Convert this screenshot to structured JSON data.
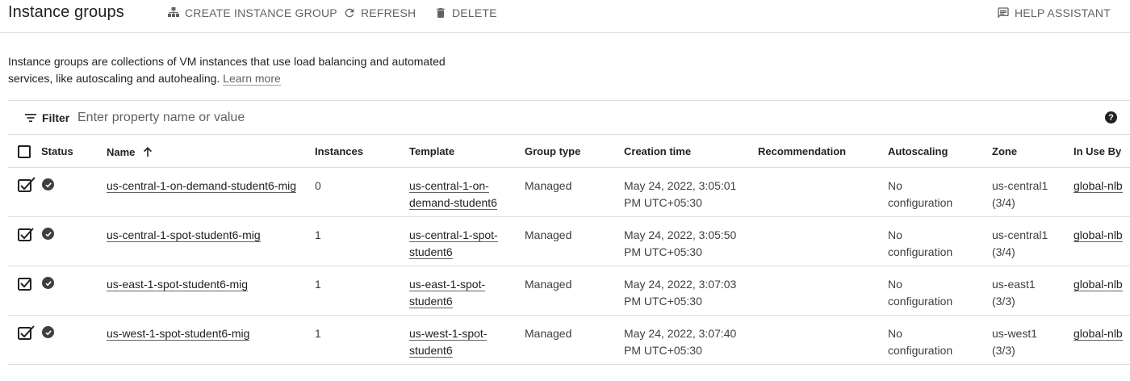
{
  "header": {
    "title": "Instance groups",
    "create_label": "CREATE INSTANCE GROUP",
    "refresh_label": "REFRESH",
    "delete_label": "DELETE",
    "help_label": "HELP ASSISTANT"
  },
  "description": {
    "text": "Instance groups are collections of VM instances that use load balancing and automated services, like autoscaling and autohealing.",
    "learn_more": "Learn more"
  },
  "filter": {
    "label": "Filter",
    "placeholder": "Enter property name or value",
    "help": "?"
  },
  "columns": {
    "status": "Status",
    "name": "Name",
    "instances": "Instances",
    "template": "Template",
    "group_type": "Group type",
    "creation_time": "Creation time",
    "recommendation": "Recommendation",
    "autoscaling": "Autoscaling",
    "zone": "Zone",
    "in_use_by": "In Use By"
  },
  "rows": [
    {
      "name": "us-central-1-on-demand-student6-mig",
      "instances": "0",
      "template_l1": "us-central-1-on-",
      "template_l2": "demand-student6",
      "group_type": "Managed",
      "time_l1": "May 24, 2022, 3:05:01",
      "time_l2": "PM UTC+05:30",
      "recommendation": "",
      "autoscaling_l1": "No",
      "autoscaling_l2": "configuration",
      "zone_l1": "us-central1",
      "zone_l2": "(3/4)",
      "in_use_by": "global-nlb"
    },
    {
      "name": "us-central-1-spot-student6-mig",
      "instances": "1",
      "template_l1": "us-central-1-spot-",
      "template_l2": "student6",
      "group_type": "Managed",
      "time_l1": "May 24, 2022, 3:05:50",
      "time_l2": "PM UTC+05:30",
      "recommendation": "",
      "autoscaling_l1": "No",
      "autoscaling_l2": "configuration",
      "zone_l1": "us-central1",
      "zone_l2": "(3/4)",
      "in_use_by": "global-nlb"
    },
    {
      "name": "us-east-1-spot-student6-mig",
      "instances": "1",
      "template_l1": "us-east-1-spot-",
      "template_l2": "student6",
      "group_type": "Managed",
      "time_l1": "May 24, 2022, 3:07:03",
      "time_l2": "PM UTC+05:30",
      "recommendation": "",
      "autoscaling_l1": "No",
      "autoscaling_l2": "configuration",
      "zone_l1": "us-east1",
      "zone_l2": "(3/3)",
      "in_use_by": "global-nlb"
    },
    {
      "name": "us-west-1-spot-student6-mig",
      "instances": "1",
      "template_l1": "us-west-1-spot-",
      "template_l2": "student6",
      "group_type": "Managed",
      "time_l1": "May 24, 2022, 3:07:40",
      "time_l2": "PM UTC+05:30",
      "recommendation": "",
      "autoscaling_l1": "No",
      "autoscaling_l2": "configuration",
      "zone_l1": "us-west1",
      "zone_l2": "(3/3)",
      "in_use_by": "global-nlb"
    }
  ],
  "icons": {
    "create": "instance-group-icon",
    "refresh": "refresh-icon",
    "delete": "trash-icon",
    "help": "help-assistant-icon",
    "filter": "filter-icon",
    "sort": "arrow-up-icon",
    "status": "check-circle-icon"
  },
  "colors": {
    "text": "#202124",
    "muted": "#5f6368",
    "divider": "#dadce0"
  }
}
